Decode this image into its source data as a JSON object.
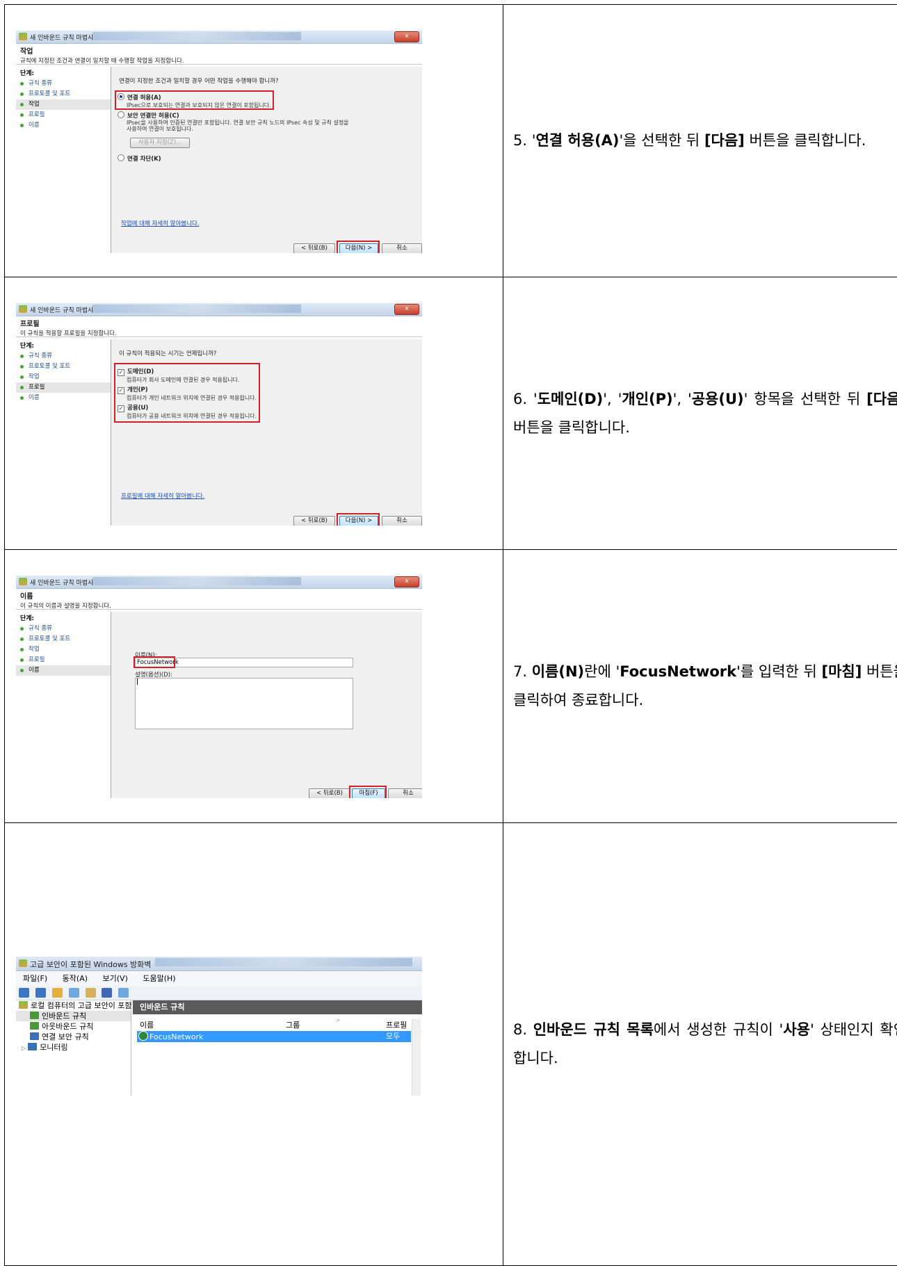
{
  "rows": [
    {
      "shot": {
        "window_title": "새 인바운드 규칙 마법사",
        "close_label": "x",
        "page_title": "작업",
        "page_subtitle": "규칙에 지정된 조건과 연결이 일치할 때 수행할 작업을 지정합니다.",
        "steps_label": "단계:",
        "steps": [
          "규칙 종류",
          "프로토콜 및 포트",
          "작업",
          "프로필",
          "이름"
        ],
        "active_step": 2,
        "question": "연결이 지정한 조건과 일치할 경우 어떤 작업을 수행해야 합니까?",
        "options": [
          {
            "title": "연결 허용(A)",
            "desc": "IPsec으로 보호되는 연결과 보호되지 않은 연결이 포함됩니다.",
            "selected": true
          },
          {
            "title": "보안 연결만 허용(C)",
            "desc": "IPsec을 사용하여 인증된 연결만 포함됩니다. 연결 보안 규칙 노드의 IPsec 속성 및 규칙 설정을 사용하여 연결이 보호됩니다.",
            "selected": false
          },
          {
            "title": "연결 차단(K)",
            "desc": "",
            "selected": false
          }
        ],
        "custom_button": "사용자 지정(Z)...",
        "learn_link": "작업에 대해 자세히 알아봅니다.",
        "back_button": "< 뒤로(B)",
        "next_button": "다음(N) >",
        "cancel_button": "취소"
      },
      "text": {
        "prefix": "5. '",
        "b1": "연결 허용(A)",
        "mid1": "'을 선택한 뒤 ",
        "b2": "[다음]",
        "suffix": " 버튼을 클릭합니다."
      }
    },
    {
      "shot": {
        "window_title": "새 인바운드 규칙 마법사",
        "close_label": "x",
        "page_title": "프로필",
        "page_subtitle": "이 규칙을 적용할 프로필을 지정합니다.",
        "steps_label": "단계:",
        "steps": [
          "규칙 종류",
          "프로토콜 및 포트",
          "작업",
          "프로필",
          "이름"
        ],
        "active_step": 3,
        "question": "이 규칙이 적용되는 시기는 언제입니까?",
        "options": [
          {
            "title": "도메인(D)",
            "desc": "컴퓨터가 회사 도메인에 연결된 경우 적용됩니다.",
            "checked": true
          },
          {
            "title": "개인(P)",
            "desc": "컴퓨터가 개인 네트워크 위치에 연결된 경우 적용됩니다.",
            "checked": true
          },
          {
            "title": "공용(U)",
            "desc": "컴퓨터가 공용 네트워크 위치에 연결된 경우 적용됩니다.",
            "checked": true
          }
        ],
        "learn_link": "프로필에 대해 자세히 알아봅니다.",
        "back_button": "< 뒤로(B)",
        "next_button": "다음(N) >",
        "cancel_button": "취소"
      },
      "text": {
        "prefix": "6. '",
        "b1": "도메인(D)",
        "mid1": "', '",
        "b2": "개인(P)",
        "mid2": "', '",
        "b3": "공용(U)",
        "mid3": "' 항목을 선택한 뒤 ",
        "b4": "[다음]",
        "suffix": " 버튼을 클릭합니다."
      }
    },
    {
      "shot": {
        "window_title": "새 인바운드 규칙 마법사",
        "close_label": "x",
        "page_title": "이름",
        "page_subtitle": "이 규칙의 이름과 설명을 지정합니다.",
        "steps_label": "단계:",
        "steps": [
          "규칙 종류",
          "프로토콜 및 포트",
          "작업",
          "프로필",
          "이름"
        ],
        "active_step": 4,
        "name_label": "이름(N):",
        "name_value": "FocusNetwork",
        "desc_label": "설명(옵션)(D):",
        "desc_value": "",
        "back_button": "< 뒤로(B)",
        "finish_button": "마침(F)",
        "cancel_button": "취소"
      },
      "text": {
        "prefix": "7. ",
        "b1": "이름(N)",
        "mid1": "란에 '",
        "b2": "FocusNetwork",
        "mid2": "'를 입력한 뒤 ",
        "b3": "[마침]",
        "suffix": " 버튼을 클릭하여 종료합니다."
      }
    },
    {
      "shot": {
        "window_title": "고급 보안이 포함된 Windows 방화벽",
        "menu": [
          "파일(F)",
          "동작(A)",
          "보기(V)",
          "도움말(H)"
        ],
        "tree": [
          "로컬 컴퓨터의 고급 보안이 포함",
          "인바운드 규칙",
          "아웃바운드 규칙",
          "연결 보안 규칙",
          "모니터링"
        ],
        "pane_title": "인바운드 규칙",
        "columns": [
          "이름",
          "그룹",
          "프로필"
        ],
        "rows": [
          {
            "name": "FocusNetwork",
            "group": "",
            "profile": "모두"
          }
        ]
      },
      "text": {
        "prefix": "8. ",
        "b1": "인바운드 규칙 목록",
        "mid1": "에서 생성한 규칙이 '",
        "b2": "사용",
        "suffix": "' 상태인지 확인합니다."
      }
    }
  ]
}
